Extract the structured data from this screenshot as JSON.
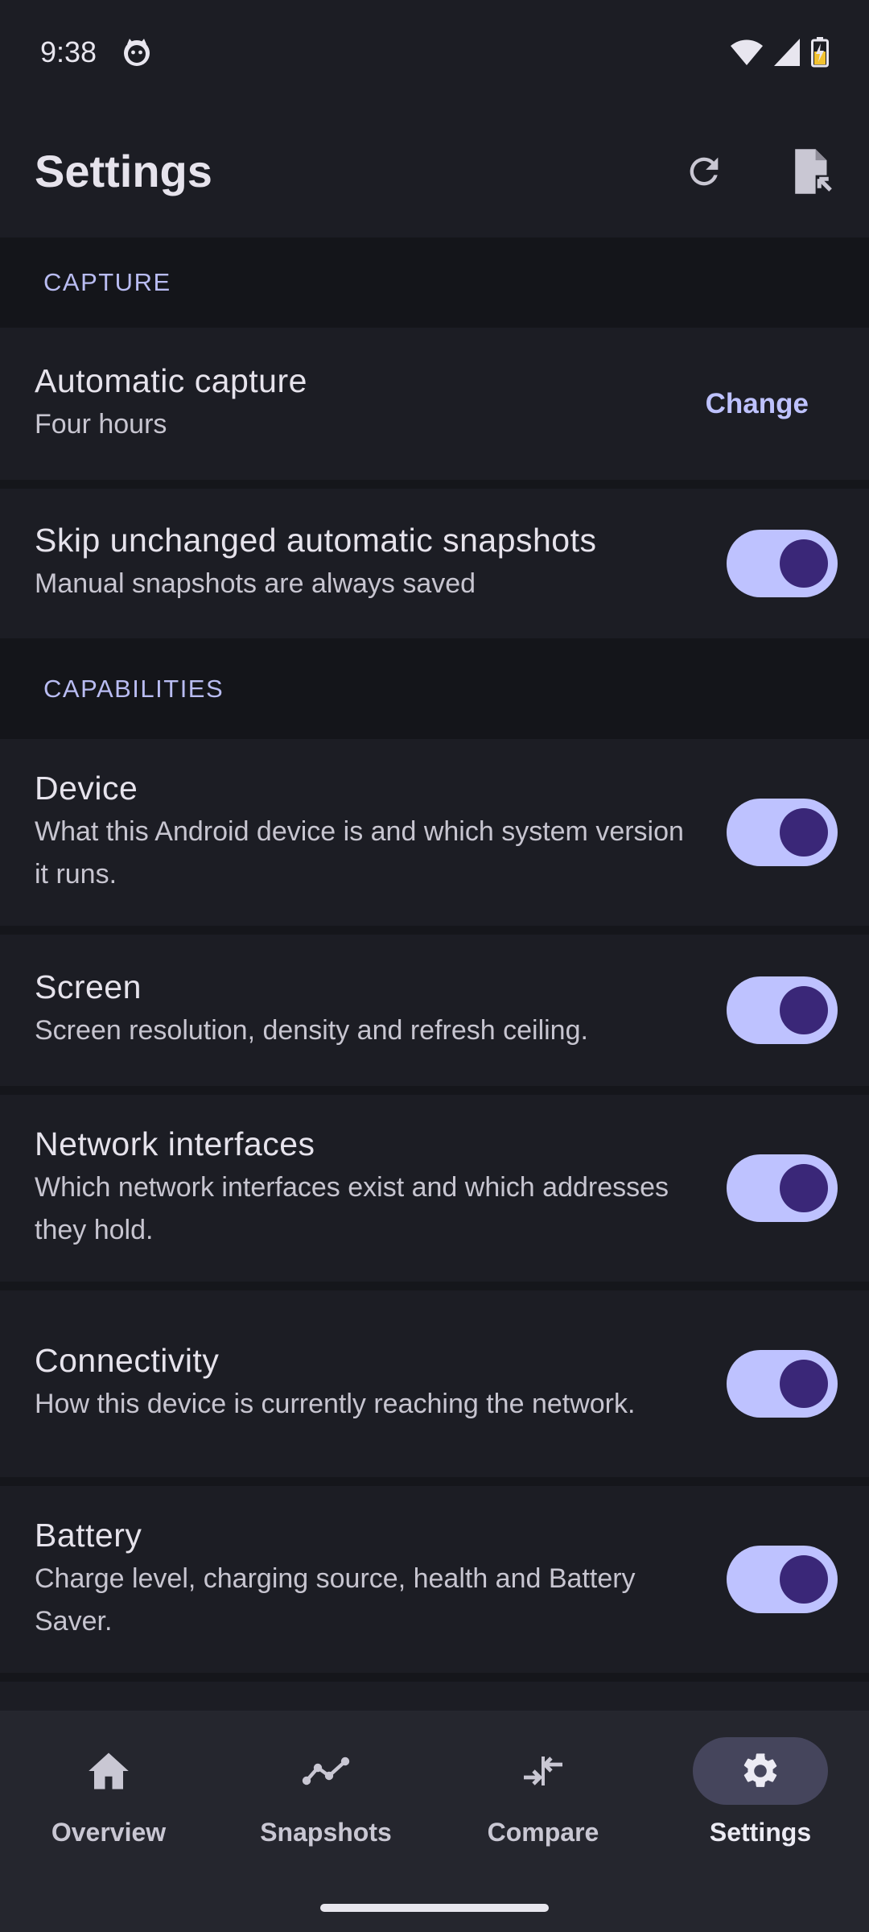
{
  "status": {
    "time": "9:38"
  },
  "header": {
    "title": "Settings"
  },
  "sections": {
    "capture": {
      "label": "CAPTURE",
      "automatic_capture": {
        "title": "Automatic capture",
        "subtitle": "Four hours",
        "action": "Change"
      },
      "skip_unchanged": {
        "title": "Skip unchanged automatic snapshots",
        "subtitle": "Manual snapshots are always saved",
        "enabled": true
      }
    },
    "capabilities": {
      "label": "CAPABILITIES",
      "items": [
        {
          "title": "Device",
          "subtitle": "What this Android device is and which system version it runs.",
          "enabled": true
        },
        {
          "title": "Screen",
          "subtitle": "Screen resolution, density and refresh ceiling.",
          "enabled": true
        },
        {
          "title": "Network interfaces",
          "subtitle": "Which network interfaces exist and which addresses they hold.",
          "enabled": true
        },
        {
          "title": "Connectivity",
          "subtitle": "How this device is currently reaching the network.",
          "enabled": true
        },
        {
          "title": "Battery",
          "subtitle": "Charge level, charging source, health and Battery Saver.",
          "enabled": true
        }
      ]
    }
  },
  "bottom_nav": {
    "items": [
      {
        "label": "Overview",
        "icon": "home-icon"
      },
      {
        "label": "Snapshots",
        "icon": "timeline-icon"
      },
      {
        "label": "Compare",
        "icon": "compare-arrows-icon"
      },
      {
        "label": "Settings",
        "icon": "gear-icon",
        "active": true
      }
    ]
  },
  "colors": {
    "accent": "#bec2ff",
    "thumb": "#3a2778",
    "background": "#1c1d24"
  }
}
